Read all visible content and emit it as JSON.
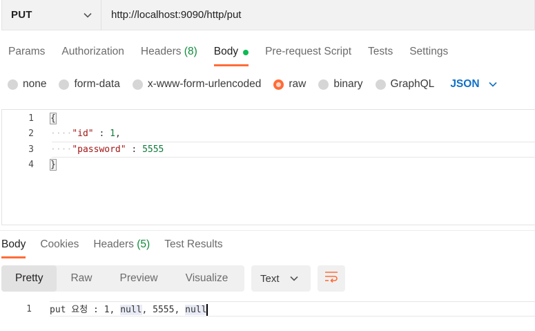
{
  "request": {
    "method": "PUT",
    "url": "http://localhost:9090/http/put"
  },
  "request_tabs": [
    {
      "label": "Params"
    },
    {
      "label": "Authorization"
    },
    {
      "label": "Headers",
      "count": "(8)"
    },
    {
      "label": "Body",
      "active": true,
      "indicator": "green-dot"
    },
    {
      "label": "Pre-request Script"
    },
    {
      "label": "Tests"
    },
    {
      "label": "Settings"
    }
  ],
  "body_types": {
    "options": [
      "none",
      "form-data",
      "x-www-form-urlencoded",
      "raw",
      "binary",
      "GraphQL"
    ],
    "selected": "raw",
    "format": "JSON"
  },
  "editor": {
    "line_numbers": [
      "1",
      "2",
      "3",
      "4"
    ],
    "open_brace": "{",
    "close_brace": "}",
    "line2": {
      "key": "\"id\"",
      "sep": " : ",
      "value": "1",
      "trail": ","
    },
    "line3": {
      "key": "\"password\"",
      "sep": " : ",
      "value": "5555"
    }
  },
  "response_tabs": [
    {
      "label": "Body",
      "active": true
    },
    {
      "label": "Cookies"
    },
    {
      "label": "Headers",
      "count": "(5)"
    },
    {
      "label": "Test Results"
    }
  ],
  "view_modes": {
    "options": [
      "Pretty",
      "Raw",
      "Preview",
      "Visualize"
    ],
    "selected": "Pretty",
    "format": "Text",
    "wrap_icon": "wrap-lines-icon"
  },
  "response_body": {
    "line_number": "1",
    "prefix": "put 요청 : 1, ",
    "null1": "null",
    "middle": ", 5555, ",
    "null2": "null"
  },
  "colors": {
    "accent": "#ff6c37",
    "active_indicator": "#0cbb52",
    "json_link": "#0f6fc6",
    "header_count": "#0f8a3a"
  }
}
